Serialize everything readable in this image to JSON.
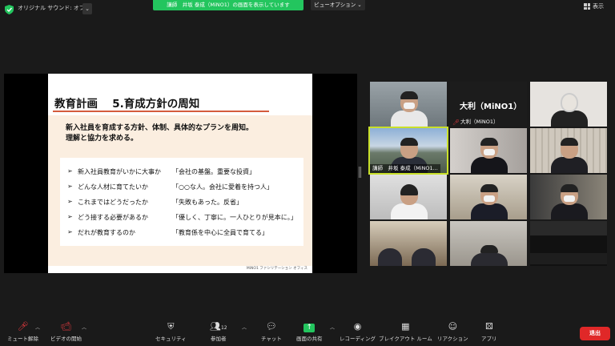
{
  "topbar": {
    "audio_label": "オリジナル サウンド: オフ",
    "audio_caret": "⌄",
    "share_banner": "講師　井坂 泰成（MiNO1）の画面を表示しています",
    "view_option": "ビューオプション ⌄",
    "display_label": "表示"
  },
  "slide": {
    "title": "教育計画　 5.育成方針の周知",
    "lead_line1": "新入社員を育成する方針、体制、具体的なプランを周知。",
    "lead_line2": "理解と協力を求める。",
    "rows": [
      {
        "arrow": "➢",
        "q": "新入社員教育がいかに大事か",
        "a": "「会社の基盤。重要な投資」"
      },
      {
        "arrow": "➢",
        "q": "どんな人材に育てたいか",
        "a": "「○○な人。会社に愛着を持つ人」"
      },
      {
        "arrow": "➢",
        "q": "これまではどうだったか",
        "a": "「失敗もあった。反省」"
      },
      {
        "arrow": "➢",
        "q": "どう接する必要があるか",
        "a": "「優しく、丁寧に。一人ひとりが見本に。」"
      },
      {
        "arrow": "➢",
        "q": "だれが教育するのか",
        "a": "「教育係を中心に全員で育てる」"
      }
    ],
    "logo": "MiNO1 ファシリテーション オフィス"
  },
  "gallery": {
    "name_tile_big": "大利（MiNO1）",
    "name_tile_small": "大利（MiNO1）",
    "speaker_name": "講師　井坂 泰成（MiNO1..."
  },
  "toolbar": {
    "mute": "ミュート解除",
    "video": "ビデオの開始",
    "security": "セキュリティ",
    "participants": "参加者",
    "participants_count": "12",
    "chat": "チャット",
    "share": "画面の共有",
    "record": "レコーディング",
    "breakout": "ブレイクアウト ルーム",
    "reaction": "リアクション",
    "apps": "アプリ",
    "end": "退出"
  },
  "colors": {
    "share_banner": "#23c55e",
    "end_button": "#e02828",
    "active_speaker": "#c9e02a",
    "slide_accent": "#d45b3d"
  }
}
